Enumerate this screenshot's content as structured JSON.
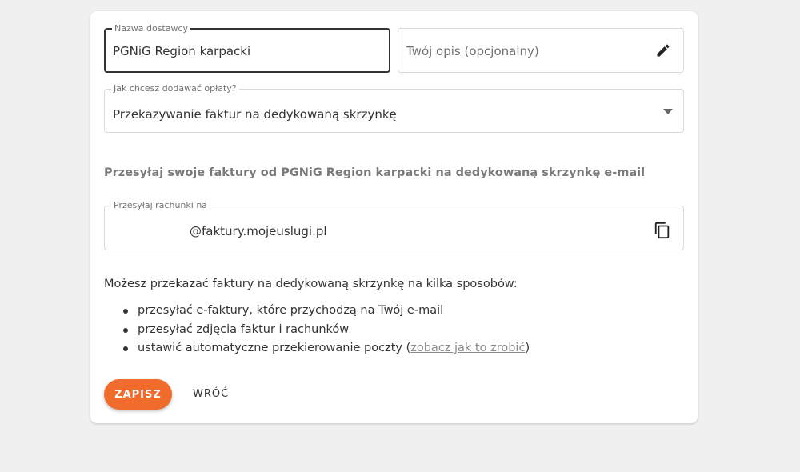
{
  "form": {
    "provider_name": {
      "label": "Nazwa dostawcy",
      "value": "PGNiG Region karpacki"
    },
    "description": {
      "placeholder": "Twój opis (opcjonalny)",
      "icon": "pencil-icon"
    },
    "billing_method": {
      "label": "Jak chcesz dodawać opłaty?",
      "value": "Przekazywanie faktur na dedykowaną skrzynkę",
      "icon": "dropdown-arrow-icon"
    }
  },
  "mailbox": {
    "title": "Przesyłaj swoje faktury od PGNiG Region karpacki na dedykowaną skrzynkę e-mail",
    "field_label": "Przesyłaj rachunki na",
    "email_suffix": "@faktury.mojeuslugi.pl",
    "copy_icon": "copy-icon"
  },
  "info": {
    "intro": "Możesz przekazać faktury na dedykowaną skrzynkę na kilka sposobów:",
    "items": [
      {
        "text": "przesyłać e-faktury, które przychodzą na Twój e-mail"
      },
      {
        "text": "przesyłać zdjęcia faktur i rachunków"
      },
      {
        "text_before": "ustawić automatyczne przekierowanie poczty (",
        "link": "zobacz jak to zrobić",
        "text_after": ")"
      }
    ]
  },
  "actions": {
    "save_label": "ZAPISZ",
    "back_label": "WRÓĆ"
  },
  "colors": {
    "accent": "#f06b2c",
    "page_background": "#f0f0f0",
    "card_background": "#ffffff"
  }
}
